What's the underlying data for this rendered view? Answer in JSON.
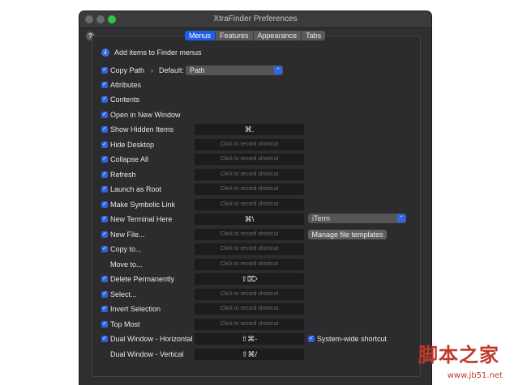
{
  "window": {
    "title": "XtraFinder Preferences",
    "help_label": "?"
  },
  "tabs": [
    {
      "label": "Menus",
      "active": true
    },
    {
      "label": "Features",
      "active": false
    },
    {
      "label": "Appearance",
      "active": false
    },
    {
      "label": "Tabs",
      "active": false
    }
  ],
  "menus": {
    "heading": "Add items to Finder menus",
    "default_label": "Default:",
    "default_value": "Path",
    "items": [
      {
        "label": "Copy Path",
        "checked": true,
        "shortcut": ""
      },
      {
        "label": "Attributes",
        "checked": true,
        "shortcut": ""
      },
      {
        "label": "Contents",
        "checked": true,
        "shortcut": ""
      },
      {
        "label": "Open in New Window",
        "checked": true,
        "shortcut": ""
      },
      {
        "label": "Show Hidden Items",
        "checked": true,
        "shortcut": "⌘."
      },
      {
        "label": "Hide Desktop",
        "checked": true,
        "shortcut": "Click to record shortcut"
      },
      {
        "label": "Collapse All",
        "checked": true,
        "shortcut": "Click to record shortcut"
      },
      {
        "label": "Refresh",
        "checked": true,
        "shortcut": "Click to record shortcut"
      },
      {
        "label": "Launch as Root",
        "checked": true,
        "shortcut": "Click to record shortcut"
      },
      {
        "label": "Make Symbolic Link",
        "checked": true,
        "shortcut": "Click to record shortcut"
      },
      {
        "label": "New Terminal Here",
        "checked": true,
        "shortcut": "⌘\\"
      },
      {
        "label": "New File...",
        "checked": true,
        "shortcut": "Click to record shortcut"
      },
      {
        "label": "Copy to...",
        "checked": true,
        "shortcut": "Click to record shortcut"
      },
      {
        "label": "Move to...",
        "checked": false,
        "shortcut": "Click to record shortcut"
      },
      {
        "label": "Delete Permanently",
        "checked": true,
        "shortcut": "⇧⌦"
      },
      {
        "label": "Select...",
        "checked": true,
        "shortcut": "Click to record shortcut"
      },
      {
        "label": "Invert Selection",
        "checked": true,
        "shortcut": "Click to record shortcut"
      },
      {
        "label": "Top Most",
        "checked": true,
        "shortcut": "Click to record shortcut"
      },
      {
        "label": "Dual Window - Horizontal",
        "checked": true,
        "shortcut": "⇧⌘-"
      },
      {
        "label": "Dual Window - Vertical",
        "checked": false,
        "shortcut": "⇧⌘/"
      }
    ],
    "terminal_app": "iTerm",
    "manage_templates_label": "Manage file templates",
    "system_wide_label": "System-wide shortcut",
    "system_wide_checked": true
  },
  "watermark": {
    "text_cn": "脚本之家",
    "url": "www.jb51.net"
  }
}
